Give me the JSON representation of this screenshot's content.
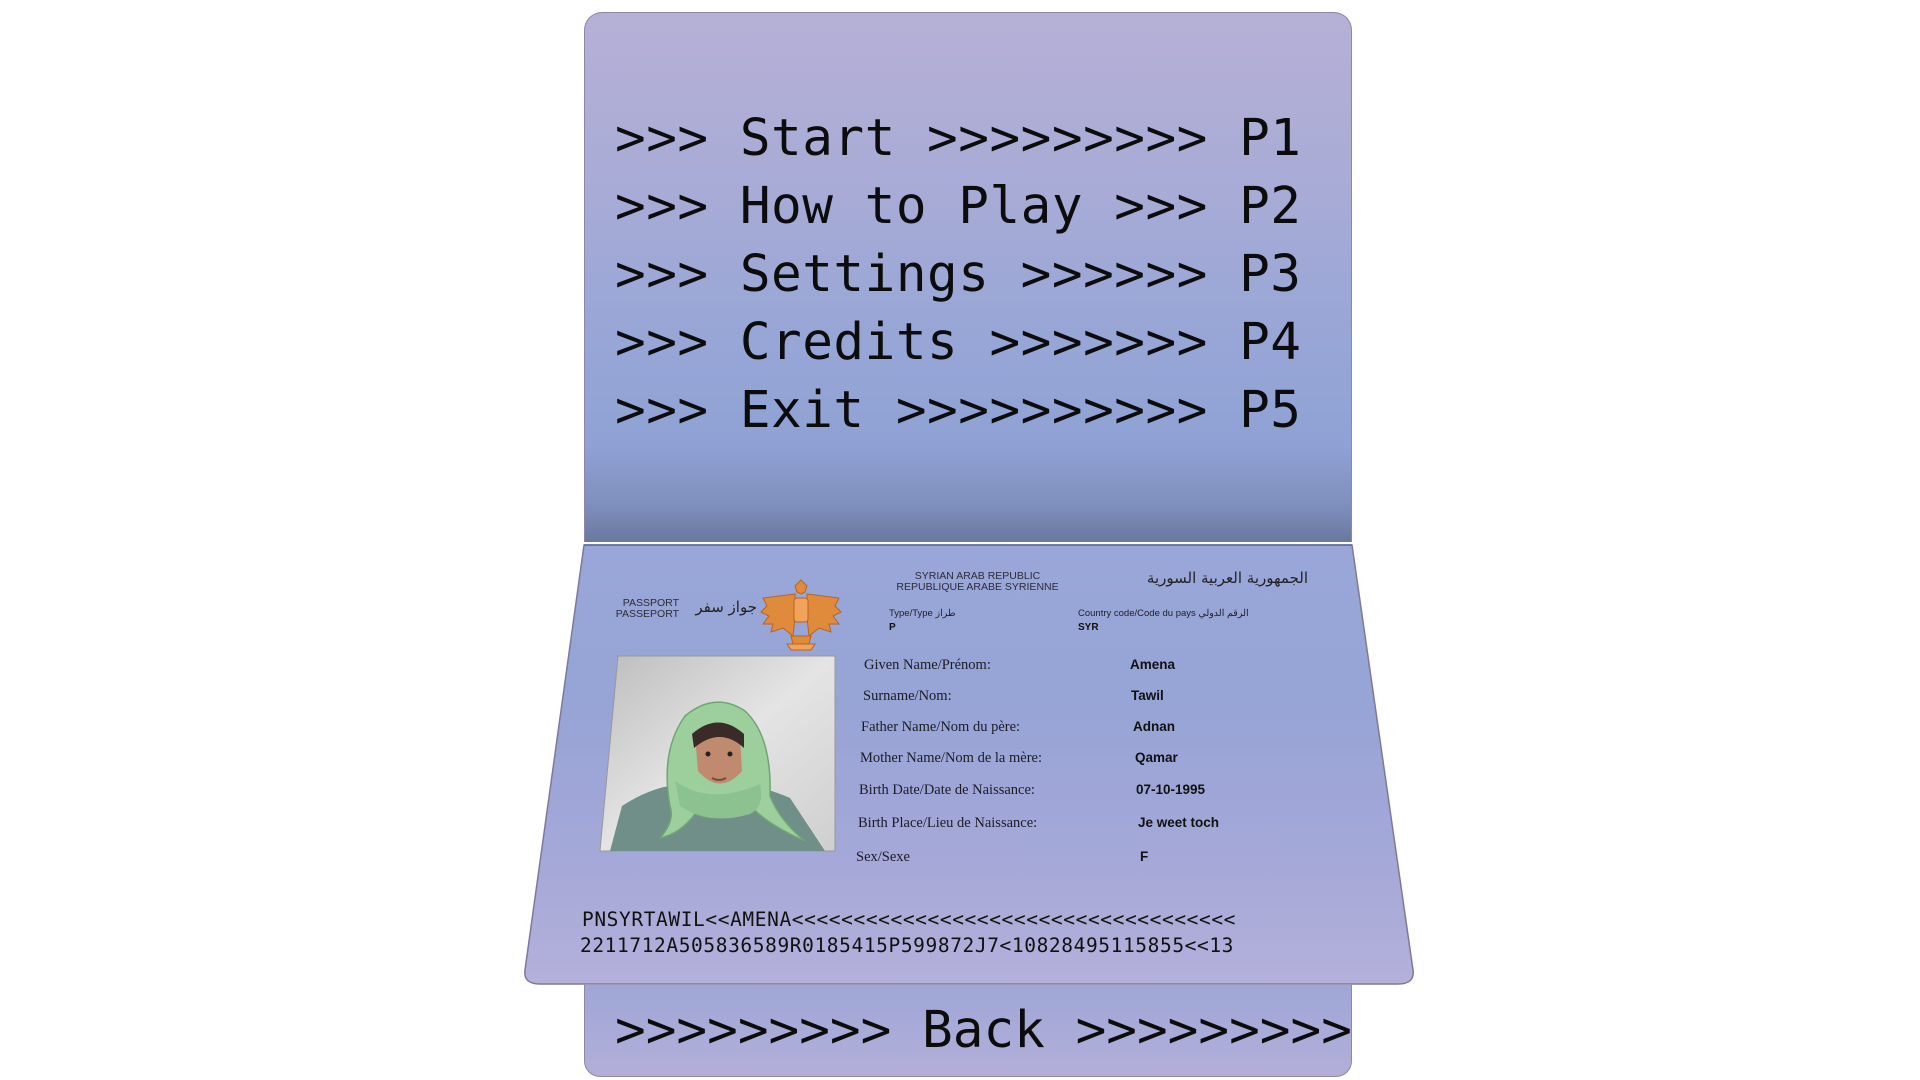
{
  "menu": {
    "items": [
      {
        "label": ">>> Start >>>>>>>>> P1"
      },
      {
        "label": ">>> How to Play >>> P2"
      },
      {
        "label": ">>> Settings >>>>>> P3"
      },
      {
        "label": ">>> Credits >>>>>>> P4"
      },
      {
        "label": ">>> Exit >>>>>>>>>> P5"
      }
    ],
    "back_label": ">>>>>>>>> Back >>>>>>>>>"
  },
  "passport": {
    "passport_en": "PASSPORT",
    "passport_fr": "PASSEPORT",
    "passport_ar": "جواز سفر",
    "country_en": "SYRIAN ARAB REPUBLIC",
    "country_fr": "REPUBLIQUE ARABE SYRIENNE",
    "country_ar": "الجمهورية العربية السورية",
    "type_label": "Type/Type طراز",
    "type_value": "P",
    "code_label": "Country code/Code du pays الرقم الدولي",
    "code_value": "SYR",
    "fields": [
      {
        "label": "Given Name/Prénom:",
        "value": "Amena"
      },
      {
        "label": "Surname/Nom:",
        "value": "Tawil"
      },
      {
        "label": "Father Name/Nom du père:",
        "value": "Adnan"
      },
      {
        "label": "Mother Name/Nom de la mère:",
        "value": "Qamar"
      },
      {
        "label": "Birth Date/Date de Naissance:",
        "value": "07-10-1995"
      },
      {
        "label": "Birth Place/Lieu de Naissance:",
        "value": "Je weet toch"
      },
      {
        "label": "Sex/Sexe",
        "value": "F"
      }
    ],
    "mrz_line1": "PNSYRTAWIL<<AMENA<<<<<<<<<<<<<<<<<<<<<<<<<<<<<<<<<<<<",
    "mrz_line2": "2211712A505836589R0185415P599872J7<10828495115855<<13"
  },
  "colors": {
    "page_top": "#b6b0d6",
    "page_mid": "#97a6d6",
    "emblem": "#e08a3c",
    "scarf": "#9ccf9c"
  },
  "icons": [
    "syrian-eagle-emblem-icon",
    "portrait-photo"
  ]
}
